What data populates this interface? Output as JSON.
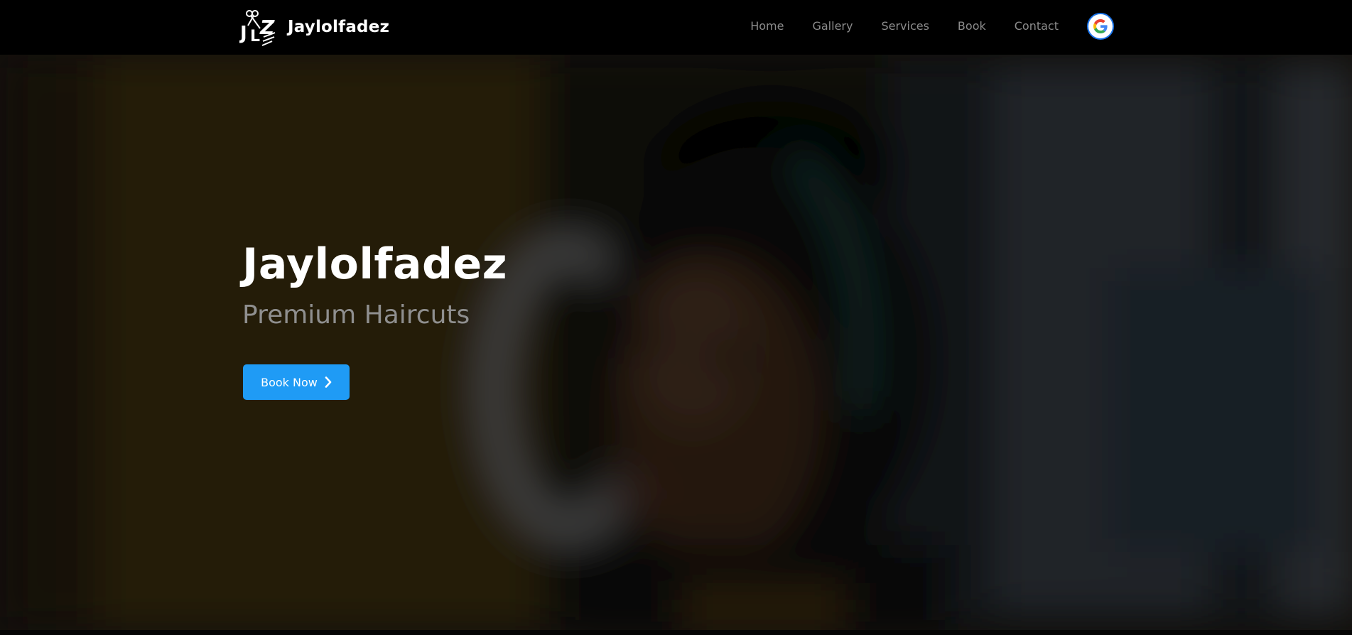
{
  "brand": {
    "logo_icon": "jlz-scissors-logo",
    "name": "Jaylolfadez"
  },
  "nav": {
    "links": [
      {
        "label": "Home"
      },
      {
        "label": "Gallery"
      },
      {
        "label": "Services"
      },
      {
        "label": "Book"
      },
      {
        "label": "Contact"
      }
    ],
    "signin_icon": "google-icon"
  },
  "hero": {
    "title": "Jaylolfadez",
    "subtitle": "Premium Haircuts",
    "cta_label": "Book Now",
    "cta_icon": "chevron-right-icon",
    "background": "blurred-portrait-photo"
  },
  "colors": {
    "accent": "#1f9bf5",
    "navbar_bg": "#000000",
    "nav_link": "#8c8c8c",
    "subtitle": "#8f8f8f"
  }
}
